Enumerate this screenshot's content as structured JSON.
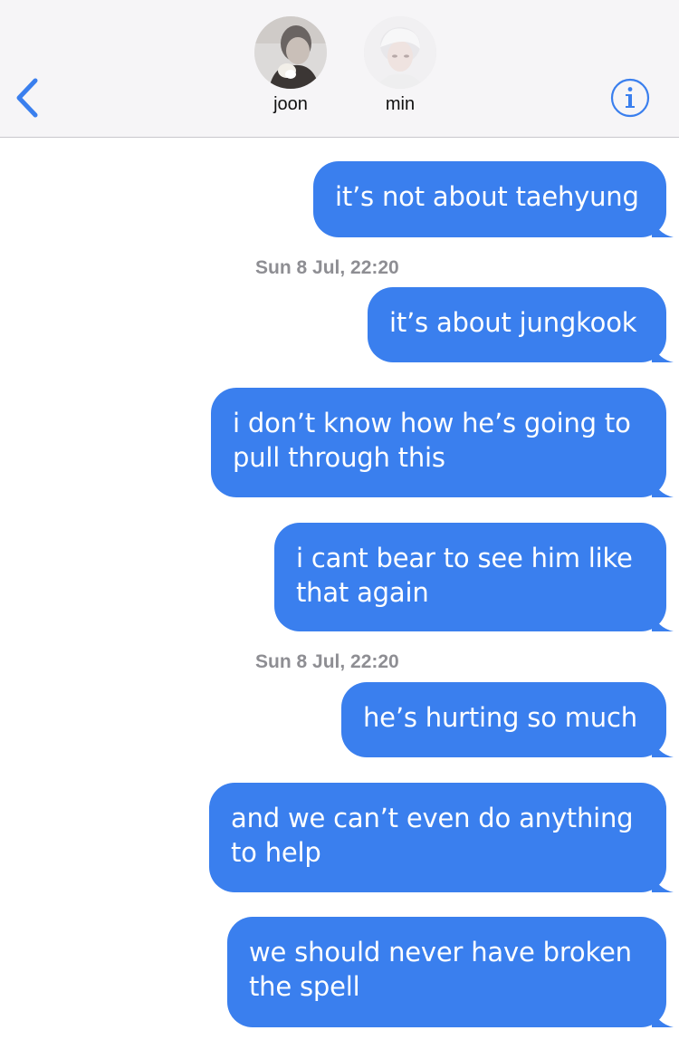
{
  "header": {
    "contacts": [
      {
        "name": "joon"
      },
      {
        "name": "min"
      }
    ],
    "back_icon": "chevron-left-icon",
    "info_icon": "info-icon",
    "accent": "#3a7fee"
  },
  "messages": [
    {
      "text": "it’s not about taehyung"
    },
    {
      "text": "it’s about jungkook"
    },
    {
      "text": "i don’t know how he’s going to pull through this"
    },
    {
      "text": "i cant bear to see him like that again"
    },
    {
      "text": "he’s hurting so much"
    },
    {
      "text": "and we can’t even do anything to help"
    },
    {
      "text": "we should never have broken the spell"
    }
  ],
  "timestamps": [
    {
      "text": "Sun 8 Jul, 22:20"
    },
    {
      "text": "Sun 8 Jul, 22:20"
    }
  ],
  "colors": {
    "bubble": "#3a7fee",
    "header_bg": "#f6f5f7",
    "timestamp": "#8e8e93"
  }
}
